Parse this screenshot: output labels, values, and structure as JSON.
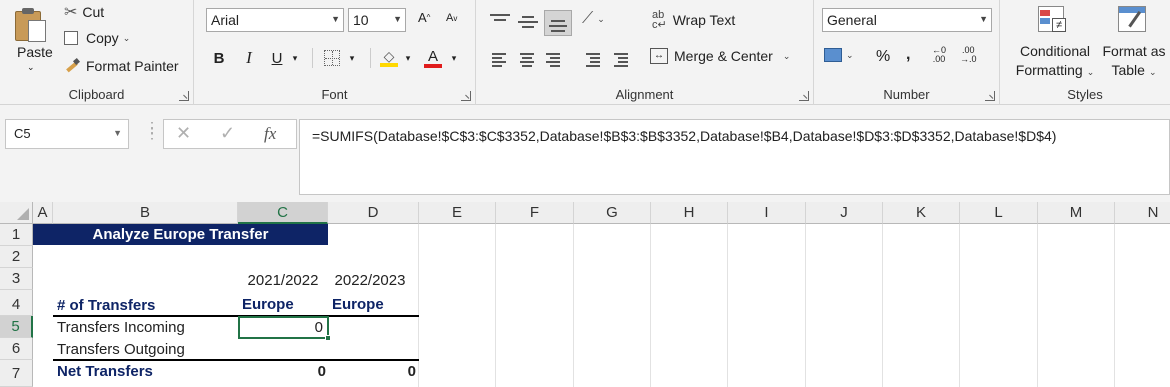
{
  "ribbon": {
    "clipboard": {
      "label": "Clipboard",
      "paste": "Paste",
      "cut": "Cut",
      "copy": "Copy",
      "format_painter": "Format Painter"
    },
    "font": {
      "label": "Font",
      "font_name": "Arial",
      "font_size": "10",
      "bold": "B",
      "italic": "I",
      "underline": "U"
    },
    "alignment": {
      "label": "Alignment",
      "wrap_text": "Wrap Text",
      "merge_center": "Merge & Center"
    },
    "number": {
      "label": "Number",
      "format": "General",
      "percent": "%",
      "comma": ","
    },
    "styles": {
      "label": "Styles",
      "conditional_line1": "Conditional",
      "conditional_line2": "Formatting",
      "format_as_line1": "Format as",
      "format_as_line2": "Table"
    }
  },
  "formula_bar": {
    "name_box": "C5",
    "fx": "fx",
    "formula": "=SUMIFS(Database!$C$3:$C$3352,Database!$B$3:$B$3352,Database!$B4,Database!$D$3:$D$3352,Database!$D$4)"
  },
  "columns": [
    "A",
    "B",
    "C",
    "D",
    "E",
    "F",
    "G",
    "H",
    "I",
    "J",
    "K",
    "L",
    "M",
    "N"
  ],
  "rows": [
    "1",
    "2",
    "3",
    "4",
    "5",
    "6",
    "7"
  ],
  "sheet": {
    "title": "Analyze Europe Transfer",
    "year1": "2021/2022",
    "year2": "2022/2023",
    "header_label": "# of Transfers",
    "region1": "Europe",
    "region2": "Europe",
    "row5_label": "Transfers Incoming",
    "row5_c": "0",
    "row6_label": "Transfers Outgoing",
    "row7_label": "Net Transfers",
    "row7_c": "0",
    "row7_d": "0"
  },
  "colors": {
    "title_fill": "#0e2466",
    "navy_text": "#0e2466",
    "excel_green": "#217346",
    "fill_yellow": "#ffd800",
    "font_red": "#e01c1c"
  }
}
